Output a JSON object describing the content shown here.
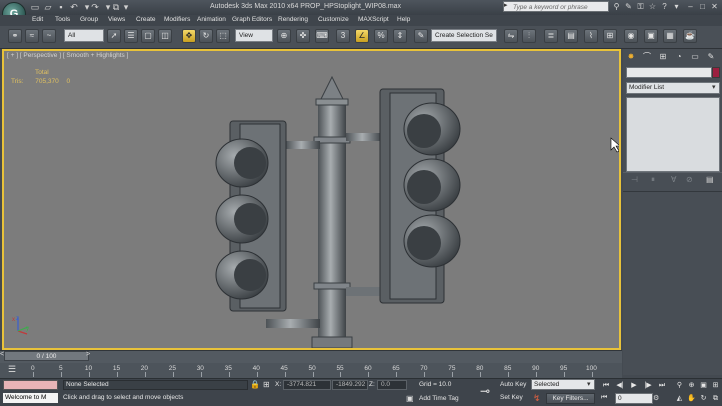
{
  "titlebar": {
    "title": "Autodesk 3ds Max  2010 x64     PROP_HPStoplight_WIP08.max",
    "search_placeholder": "Type a keyword or phrase",
    "logo": "3ds-max-logo"
  },
  "menubar": [
    "Edit",
    "Tools",
    "Group",
    "Views",
    "Create",
    "Modifiers",
    "Animation",
    "Graph Editors",
    "Rendering",
    "Customize",
    "MAXScript",
    "Help"
  ],
  "toolbar": {
    "selection_filter": "All",
    "reference_coord": "View",
    "named_selection": "Create Selection Se"
  },
  "viewport": {
    "label": "[ + ] [ Perspective ] [ Smooth + Highlights ]",
    "stats_total_label": "Total",
    "stats_tris_label": "Tris:",
    "stats_tris_value": "705,370",
    "stats_tris_sel": "0",
    "axis_x": "x",
    "axis_y": "y",
    "axis_z": "z"
  },
  "command_panel": {
    "modifier_list": "Modifier List",
    "object_color": "#9b1f3f"
  },
  "timeline": {
    "slider_text": "0 / 100",
    "ticks": [
      "0",
      "5",
      "10",
      "15",
      "20",
      "25",
      "30",
      "35",
      "40",
      "45",
      "50",
      "55",
      "60",
      "65",
      "70",
      "75",
      "80",
      "85",
      "90",
      "95",
      "100"
    ]
  },
  "statusbar": {
    "welcome": "Welcome to M",
    "selection_status": "None Selected",
    "prompt": "Click and drag to select and move objects",
    "x_label": "X:",
    "x_value": "-3774.821",
    "y_label": "Y:",
    "y_value": "-1849.292",
    "z_label": "Z:",
    "z_value": "0.0",
    "grid": "Grid = 10.0",
    "add_time_tag": "Add Time Tag",
    "auto_key": "Auto Key",
    "set_key": "Set Key",
    "selected_dropdown": "Selected",
    "key_filters": "Key Filters...",
    "current_frame": "0"
  }
}
